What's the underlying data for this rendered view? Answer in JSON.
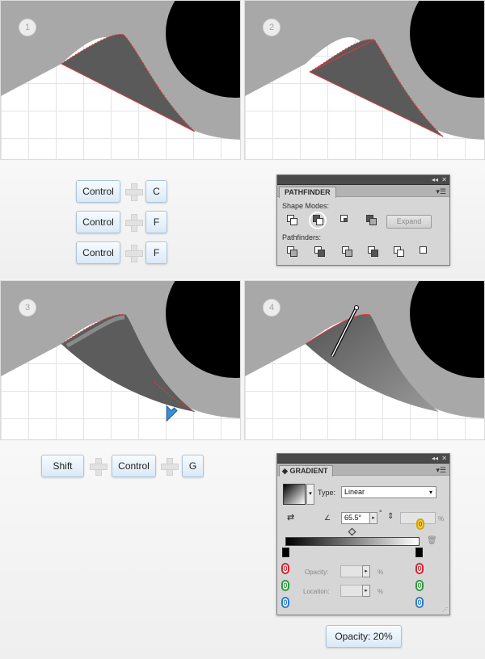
{
  "steps": {
    "step1": "1",
    "step2": "2",
    "step3": "3",
    "step4": "4"
  },
  "shortcuts_top": [
    {
      "modifier": "Control",
      "key": "C"
    },
    {
      "modifier": "Control",
      "key": "F"
    },
    {
      "modifier": "Control",
      "key": "F"
    }
  ],
  "pathfinder": {
    "title": "PATHFINDER",
    "shape_modes_label": "Shape Modes:",
    "pathfinders_label": "Pathfinders:",
    "expand_label": "Expand",
    "collapse_icon": "double-arrow-icon",
    "close_icon": "close-icon"
  },
  "shortcut_group": {
    "key1": "Shift",
    "key2": "Control",
    "key3": "G"
  },
  "gradient": {
    "title": "GRADIENT",
    "type_label": "Type:",
    "type_value": "Linear",
    "angle_value": "65.5°",
    "degree_symbol": "°",
    "aspect_value": "",
    "percent": "%",
    "opacity_label": "Opacity:",
    "location_label": "Location:",
    "badge_zero": "0",
    "yellow_badge": "0"
  },
  "opacity_note": "Opacity: 20%",
  "colors": {
    "accent_red": "#e0383e",
    "shape_grey": "#a8a8a8",
    "black": "#000000",
    "cursor_blue": "#3a8fd6"
  }
}
